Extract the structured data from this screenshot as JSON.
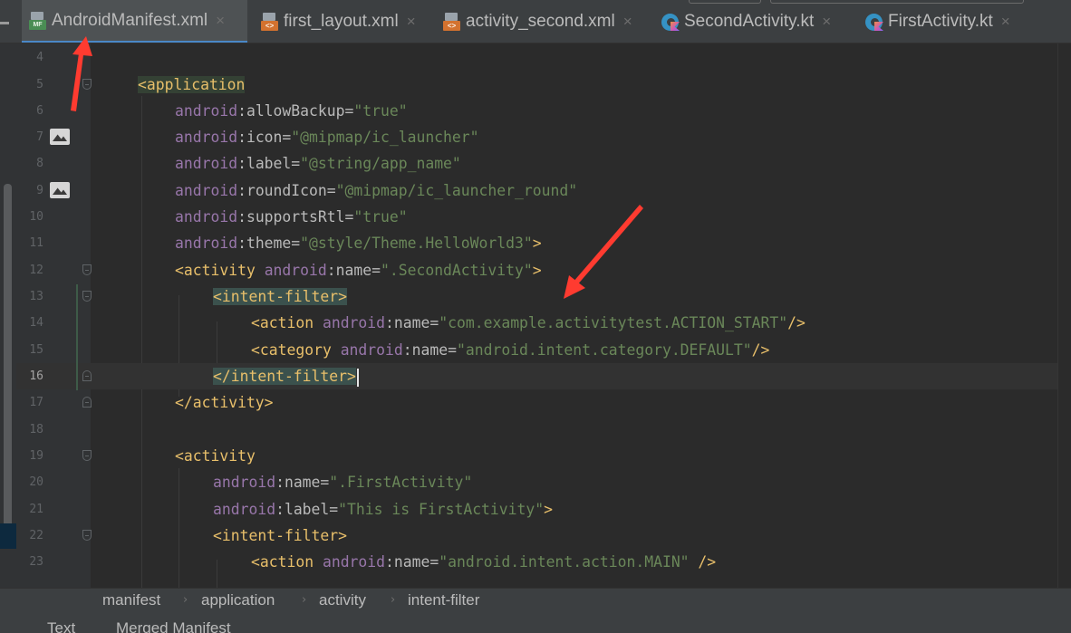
{
  "tabs": [
    {
      "label": "AndroidManifest.xml",
      "icon": "manifest-file-icon",
      "active": true
    },
    {
      "label": "first_layout.xml",
      "icon": "layout-xml-file-icon",
      "active": false
    },
    {
      "label": "activity_second.xml",
      "icon": "layout-xml-file-icon",
      "active": false
    },
    {
      "label": "SecondActivity.kt",
      "icon": "kotlin-class-file-icon",
      "active": false
    },
    {
      "label": "FirstActivity.kt",
      "icon": "kotlin-class-file-icon",
      "active": false
    }
  ],
  "tab_close_glyph": "×",
  "icon_badges": {
    "manifest": "MF",
    "xml": "<>"
  },
  "editor": {
    "current_line": 16,
    "line_numbers": [
      "4",
      "5",
      "6",
      "7",
      "8",
      "9",
      "10",
      "11",
      "12",
      "13",
      "14",
      "15",
      "16",
      "17",
      "18",
      "19",
      "20",
      "21",
      "22",
      "23"
    ],
    "code": {
      "l5_tag": "<application",
      "l6": {
        "ns": "android",
        "attr": ":allowBackup",
        "eq": "=",
        "val": "\"true\""
      },
      "l7": {
        "ns": "android",
        "attr": ":icon",
        "eq": "=",
        "val": "\"@mipmap/ic_launcher\""
      },
      "l8": {
        "ns": "android",
        "attr": ":label",
        "eq": "=",
        "val": "\"@string/app_name\""
      },
      "l9": {
        "ns": "android",
        "attr": ":roundIcon",
        "eq": "=",
        "val": "\"@mipmap/ic_launcher_round\""
      },
      "l10": {
        "ns": "android",
        "attr": ":supportsRtl",
        "eq": "=",
        "val": "\"true\""
      },
      "l11": {
        "ns": "android",
        "attr": ":theme",
        "eq": "=",
        "val": "\"@style/Theme.HelloWorld3\"",
        "end": ">"
      },
      "l12": {
        "tag": "<activity",
        "ns": "android",
        "attr": ":name",
        "eq": "=",
        "val": "\".SecondActivity\"",
        "end": ">"
      },
      "l13_tag": "<intent-filter>",
      "l14": {
        "tag": "<action",
        "ns": "android",
        "attr": ":name",
        "eq": "=",
        "val": "\"com.example.activitytest.ACTION_START\"",
        "end": "/>"
      },
      "l15": {
        "tag": "<category",
        "ns": "android",
        "attr": ":name",
        "eq": "=",
        "val": "\"android.intent.category.DEFAULT\"",
        "end": "/>"
      },
      "l16_tag": "</intent-filter",
      "l16_end": ">",
      "l17_tag": "</activity>",
      "l19_tag": "<activity",
      "l20": {
        "ns": "android",
        "attr": ":name",
        "eq": "=",
        "val": "\".FirstActivity\""
      },
      "l21": {
        "ns": "android",
        "attr": ":label",
        "eq": "=",
        "val": "\"This is FirstActivity\"",
        "end": ">"
      },
      "l22_tag": "<intent-filter>",
      "l23": {
        "tag": "<action",
        "ns": "android",
        "attr": ":name",
        "eq": "=",
        "val": "\"android.intent.action.MAIN\"",
        "end": " />"
      }
    }
  },
  "breadcrumb": [
    "manifest",
    "application",
    "activity",
    "intent-filter"
  ],
  "breadcrumb_separator": "›",
  "bottom_tabs": [
    "Text",
    "Merged Manifest"
  ],
  "colors": {
    "tag": "#e8bf6a",
    "namespace": "#9876aa",
    "attribute": "#bababa",
    "string": "#6a8759",
    "annotation_arrow": "#ff3b30",
    "active_tab_underline": "#4a88c7"
  }
}
